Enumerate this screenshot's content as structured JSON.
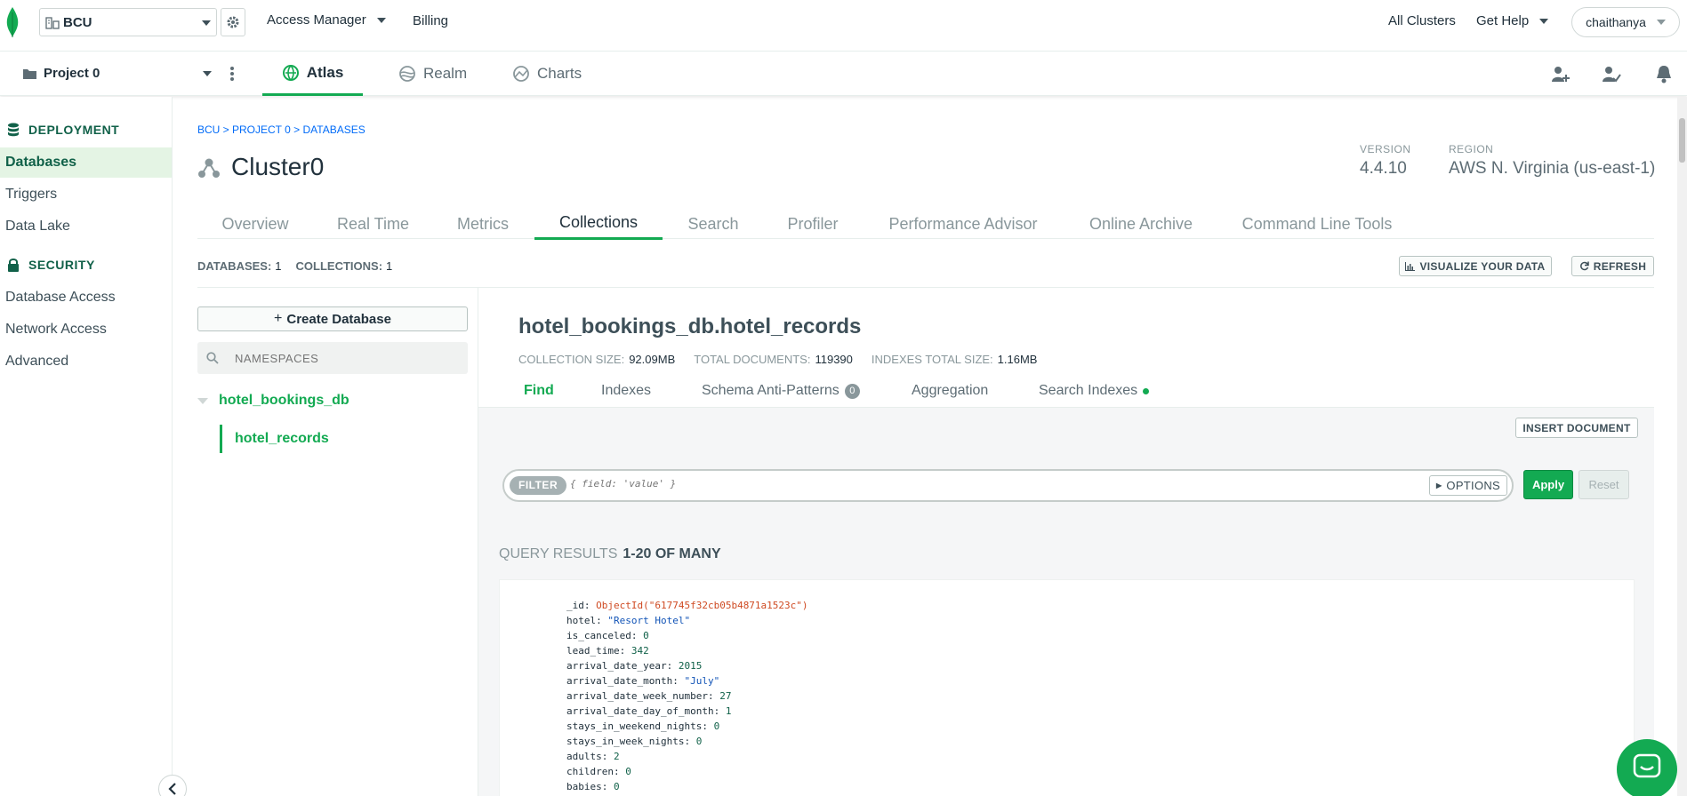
{
  "topbar": {
    "org": "BCU",
    "access_manager": "Access Manager",
    "billing": "Billing",
    "all_clusters": "All Clusters",
    "get_help": "Get Help",
    "user": "chaithanya"
  },
  "projbar": {
    "project": "Project 0",
    "tabs": [
      "Atlas",
      "Realm",
      "Charts"
    ]
  },
  "sidebar": {
    "deployment_heading": "DEPLOYMENT",
    "deployment_items": [
      "Databases",
      "Triggers",
      "Data Lake"
    ],
    "security_heading": "SECURITY",
    "security_items": [
      "Database Access",
      "Network Access",
      "Advanced"
    ]
  },
  "cluster": {
    "breadcrumb": "BCU > PROJECT 0 > DATABASES",
    "name": "Cluster0",
    "version_label": "VERSION",
    "version": "4.4.10",
    "region_label": "REGION",
    "region": "AWS N. Virginia (us-east-1)"
  },
  "tabs": [
    "Overview",
    "Real Time",
    "Metrics",
    "Collections",
    "Search",
    "Profiler",
    "Performance Advisor",
    "Online Archive",
    "Command Line Tools"
  ],
  "counts": {
    "databases_label": "DATABASES:",
    "databases": "1",
    "collections_label": "COLLECTIONS:",
    "collections": "1",
    "visualize": "VISUALIZE YOUR DATA",
    "refresh": "REFRESH"
  },
  "nav": {
    "create_db": "Create Database",
    "namespaces_placeholder": "NAMESPACES",
    "db": "hotel_bookings_db",
    "collection": "hotel_records"
  },
  "collection": {
    "title": "hotel_bookings_db.hotel_records",
    "size_label": "COLLECTION SIZE:",
    "size": "92.09MB",
    "docs_label": "TOTAL DOCUMENTS:",
    "docs": "119390",
    "idx_label": "INDEXES TOTAL SIZE:",
    "idx": "1.16MB",
    "subtabs": [
      "Find",
      "Indexes",
      "Schema Anti-Patterns",
      "Aggregation",
      "Search Indexes"
    ],
    "anti_pattern_count": "0"
  },
  "query": {
    "insert": "INSERT DOCUMENT",
    "filter_tag": "FILTER",
    "filter_placeholder": "{ field: 'value' }",
    "options": "OPTIONS",
    "apply": "Apply",
    "reset": "Reset",
    "results_label": "QUERY RESULTS",
    "results_range": "1-20 OF MANY"
  },
  "document": [
    {
      "k": "_id",
      "v": "ObjectId(\"617745f32cb05b4871a1523c\")",
      "t": "oid"
    },
    {
      "k": "hotel",
      "v": "\"Resort Hotel\"",
      "t": "str"
    },
    {
      "k": "is_canceled",
      "v": "0",
      "t": "num"
    },
    {
      "k": "lead_time",
      "v": "342",
      "t": "num"
    },
    {
      "k": "arrival_date_year",
      "v": "2015",
      "t": "num"
    },
    {
      "k": "arrival_date_month",
      "v": "\"July\"",
      "t": "str"
    },
    {
      "k": "arrival_date_week_number",
      "v": "27",
      "t": "num"
    },
    {
      "k": "arrival_date_day_of_month",
      "v": "1",
      "t": "num"
    },
    {
      "k": "stays_in_weekend_nights",
      "v": "0",
      "t": "num"
    },
    {
      "k": "stays_in_week_nights",
      "v": "0",
      "t": "num"
    },
    {
      "k": "adults",
      "v": "2",
      "t": "num"
    },
    {
      "k": "children",
      "v": "0",
      "t": "num"
    },
    {
      "k": "babies",
      "v": "0",
      "t": "num"
    }
  ],
  "colors": {
    "brand_green": "#13aa52",
    "dark_green": "#116149",
    "link_blue": "#016bf8"
  }
}
